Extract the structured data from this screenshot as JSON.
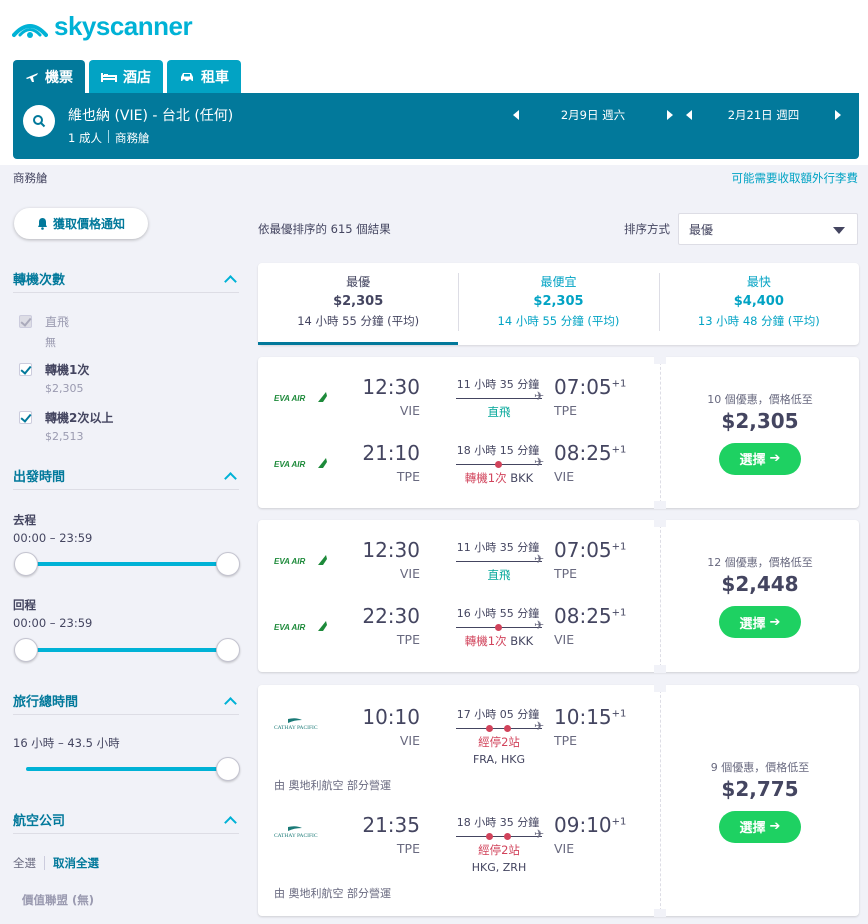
{
  "brand": {
    "name": "skyscanner",
    "color": "#00b2d6"
  },
  "tabs": [
    {
      "label": "機票",
      "icon": "plane-icon",
      "active": true
    },
    {
      "label": "酒店",
      "icon": "bed-icon",
      "active": false
    },
    {
      "label": "租車",
      "icon": "car-icon",
      "active": false
    }
  ],
  "search": {
    "route": "維也納 (VIE) - 台北 (任何)",
    "passengers": "1 成人",
    "cabin": "商務艙",
    "depart_date": "2月9日 週六",
    "return_date": "2月21日 週四"
  },
  "subheader": {
    "cabin_label": "商務艙",
    "fees_link": "可能需要收取額外行李費"
  },
  "sidebar": {
    "alert_button": "獲取價格通知",
    "stops": {
      "title": "轉機次數",
      "items": [
        {
          "label": "直飛",
          "sub": "無",
          "checked": true,
          "disabled": true
        },
        {
          "label": "轉機1次",
          "sub": "$2,305",
          "checked": true,
          "disabled": false
        },
        {
          "label": "轉機2次以上",
          "sub": "$2,513",
          "checked": true,
          "disabled": false
        }
      ]
    },
    "departure_times": {
      "title": "出發時間",
      "outbound_label": "去程",
      "outbound_range": "00:00 – 23:59",
      "return_label": "回程",
      "return_range": "00:00 – 23:59"
    },
    "journey_duration": {
      "title": "旅行總時間",
      "range": "16 小時 – 43.5 小時",
      "value_fraction": 1.0
    },
    "airlines": {
      "title": "航空公司",
      "select_all": "全選",
      "clear_all": "取消全選",
      "alliance": "價值聯盟 (無)"
    }
  },
  "results": {
    "count_text": "依最優排序的 615 個結果",
    "sort_label": "排序方式",
    "sort_value": "最優",
    "summary": [
      {
        "title": "最優",
        "price": "$2,305",
        "duration": "14 小時 55 分鐘 (平均)",
        "active": true
      },
      {
        "title": "最便宜",
        "price": "$2,305",
        "duration": "14 小時 55 分鐘 (平均)",
        "active": false
      },
      {
        "title": "最快",
        "price": "$4,400",
        "duration": "13 小時 48 分鐘 (平均)",
        "active": false
      }
    ],
    "cards": [
      {
        "airline": "EVA AIR",
        "deals": "10 個優惠，價格低至",
        "price": "$2,305",
        "select_label": "選擇",
        "legs": [
          {
            "dep_time": "12:30",
            "dep_code": "VIE",
            "duration": "11 小時 35 分鐘",
            "stops": "直飛",
            "stops_type": "direct",
            "arr_time": "07:05",
            "arr_plus": "+1",
            "arr_code": "TPE",
            "via": ""
          },
          {
            "dep_time": "21:10",
            "dep_code": "TPE",
            "duration": "18 小時 15 分鐘",
            "stops": "轉機1次",
            "stops_via": "BKK",
            "stops_type": "one",
            "arr_time": "08:25",
            "arr_plus": "+1",
            "arr_code": "VIE",
            "via": ""
          }
        ]
      },
      {
        "airline": "EVA AIR",
        "deals": "12 個優惠，價格低至",
        "price": "$2,448",
        "select_label": "選擇",
        "legs": [
          {
            "dep_time": "12:30",
            "dep_code": "VIE",
            "duration": "11 小時 35 分鐘",
            "stops": "直飛",
            "stops_type": "direct",
            "arr_time": "07:05",
            "arr_plus": "+1",
            "arr_code": "TPE",
            "via": ""
          },
          {
            "dep_time": "22:30",
            "dep_code": "TPE",
            "duration": "16 小時 55 分鐘",
            "stops": "轉機1次",
            "stops_via": "BKK",
            "stops_type": "one",
            "arr_time": "08:25",
            "arr_plus": "+1",
            "arr_code": "VIE",
            "via": ""
          }
        ]
      },
      {
        "airline": "CATHAY PACIFIC",
        "deals": "9 個優惠，價格低至",
        "price": "$2,775",
        "select_label": "選擇",
        "operated_by": "由 奧地利航空 部分營運",
        "legs": [
          {
            "dep_time": "10:10",
            "dep_code": "VIE",
            "duration": "17 小時 05 分鐘",
            "stops": "經停2站",
            "stops_type": "two",
            "arr_time": "10:15",
            "arr_plus": "+1",
            "arr_code": "TPE",
            "via": "FRA, HKG"
          },
          {
            "dep_time": "21:35",
            "dep_code": "TPE",
            "duration": "18 小時 35 分鐘",
            "stops": "經停2站",
            "stops_type": "two",
            "arr_time": "09:10",
            "arr_plus": "+1",
            "arr_code": "VIE",
            "via": "HKG, ZRH"
          }
        ]
      }
    ]
  }
}
